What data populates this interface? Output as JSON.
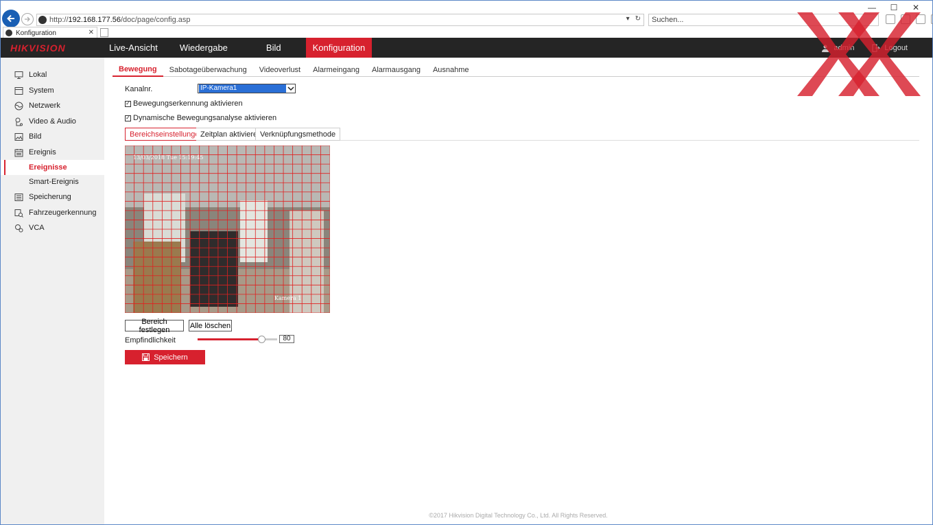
{
  "browser": {
    "url_prefix": "http://",
    "url_host": "192.168.177.56",
    "url_path": "/doc/page/config.asp",
    "search_placeholder": "Suchen...",
    "tab_title": "Konfiguration"
  },
  "app": {
    "logo": "HIKVISION",
    "nav": [
      "Live-Ansicht",
      "Wiedergabe",
      "Bild",
      "Konfiguration"
    ],
    "active_nav": "Konfiguration",
    "user": "admin",
    "logout": "Logout"
  },
  "sidebar": {
    "items": [
      {
        "label": "Lokal",
        "icon": "monitor-icon"
      },
      {
        "label": "System",
        "icon": "system-icon"
      },
      {
        "label": "Netzwerk",
        "icon": "network-icon"
      },
      {
        "label": "Video & Audio",
        "icon": "video-audio-icon"
      },
      {
        "label": "Bild",
        "icon": "image-icon"
      },
      {
        "label": "Ereignis",
        "icon": "calendar-icon"
      },
      {
        "label": "Ereignisse",
        "icon": ""
      },
      {
        "label": "Smart-Ereignis",
        "icon": ""
      },
      {
        "label": "Speicherung",
        "icon": "storage-icon"
      },
      {
        "label": "Fahrzeugerkennung",
        "icon": "vehicle-search-icon"
      },
      {
        "label": "VCA",
        "icon": "vca-icon"
      }
    ]
  },
  "subtabs": [
    "Bewegung",
    "Sabotageüberwachung",
    "Videoverlust",
    "Alarmeingang",
    "Alarmausgang",
    "Ausnahme"
  ],
  "form": {
    "channel_label": "Kanalnr.",
    "channel_value": "IP-Kamera1",
    "enable_motion": "Bewegungserkennung aktivieren",
    "enable_dynamic": "Dynamische Bewegungsanalyse aktivieren",
    "steps": [
      "Bereichseinstellungen",
      "Zeitplan aktivieren",
      "Verknüpfungsmethode"
    ],
    "camera_timestamp": "13/03/2018 Tue 15:19:45",
    "camera_name": "Kamera 1",
    "btn_set_area": "Bereich festlegen",
    "btn_clear_all": "Alle löschen",
    "sensitivity_label": "Empfindlichkeit",
    "sensitivity_value": "80",
    "save_label": "Speichern"
  },
  "footer": "©2017 Hikvision Digital Technology Co., Ltd. All Rights Reserved.",
  "colors": {
    "accent": "#d7212e",
    "header_bg": "#252525",
    "sidebar_bg": "#f0f0f0"
  }
}
